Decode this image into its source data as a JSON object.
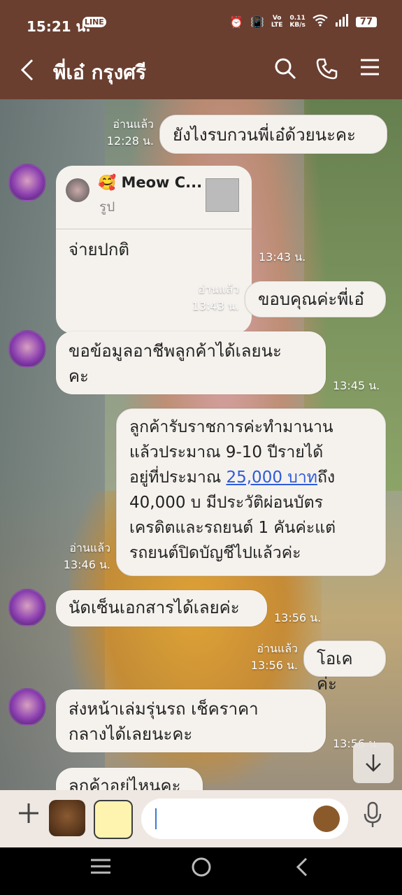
{
  "status": {
    "time": "15:21 น.",
    "net_speed": "0.11\nKB/s",
    "net_lte": "Vo))\nLTE",
    "battery": "77"
  },
  "header": {
    "title": "พี่เอ๋ กรุงศรี"
  },
  "messages": {
    "m1": {
      "text": "ยังไงรบกวนพี่เอ๋ด้วยนะคะ",
      "read": "อ่านแล้ว",
      "time": "12:28 น."
    },
    "m2": {
      "quote_name": "🥰 Meow C...",
      "quote_sub": "รูป",
      "text": "จ่ายปกติ",
      "time": "13:43 น."
    },
    "m3": {
      "text": "ขอบคุณค่ะพี่เอ๋",
      "read": "อ่านแล้ว",
      "time": "13:43 น."
    },
    "m4": {
      "line1": "ขอข้อมูลอาชีพลูกค้าได้เลยนะ",
      "line2": "คะ",
      "time": "13:45 น."
    },
    "m5": {
      "line1": "ลูกค้ารับราชการค่ะทำมานาน",
      "line2": "แล้วประมาณ 9-10 ปีรายได้",
      "line3a": "อยู่ที่ประมาณ ",
      "link": "25,000 บาท",
      "line3b": "ถึง",
      "line4": "40,000 บ มีประวัติผ่อนบัตร",
      "line5": "เครดิตและรถยนต์ 1 คันค่ะแต่",
      "line6": "รถยนต์ปิดบัญชีไปแล้วค่ะ",
      "read": "อ่านแล้ว",
      "time": "13:46 น."
    },
    "m6": {
      "text": "นัดเซ็นเอกสารได้เลยค่ะ",
      "time": "13:56 น."
    },
    "m7": {
      "text": "โอเคค่ะ",
      "read": "อ่านแล้ว",
      "time": "13:56 น."
    },
    "m8": {
      "line1": "ส่งหน้าเล่มรุ่นรถ เช็คราคา",
      "line2": "กลางได้เลยนะคะ",
      "time": "13:56 น."
    },
    "m9": {
      "text": "ลูกค้าอยู่ไหนคะ"
    }
  },
  "icons": {
    "back": "chevron-left",
    "search": "search",
    "call": "phone",
    "menu": "hamburger",
    "scroll_down": "arrow-down",
    "plus": "plus",
    "mic": "microphone"
  }
}
